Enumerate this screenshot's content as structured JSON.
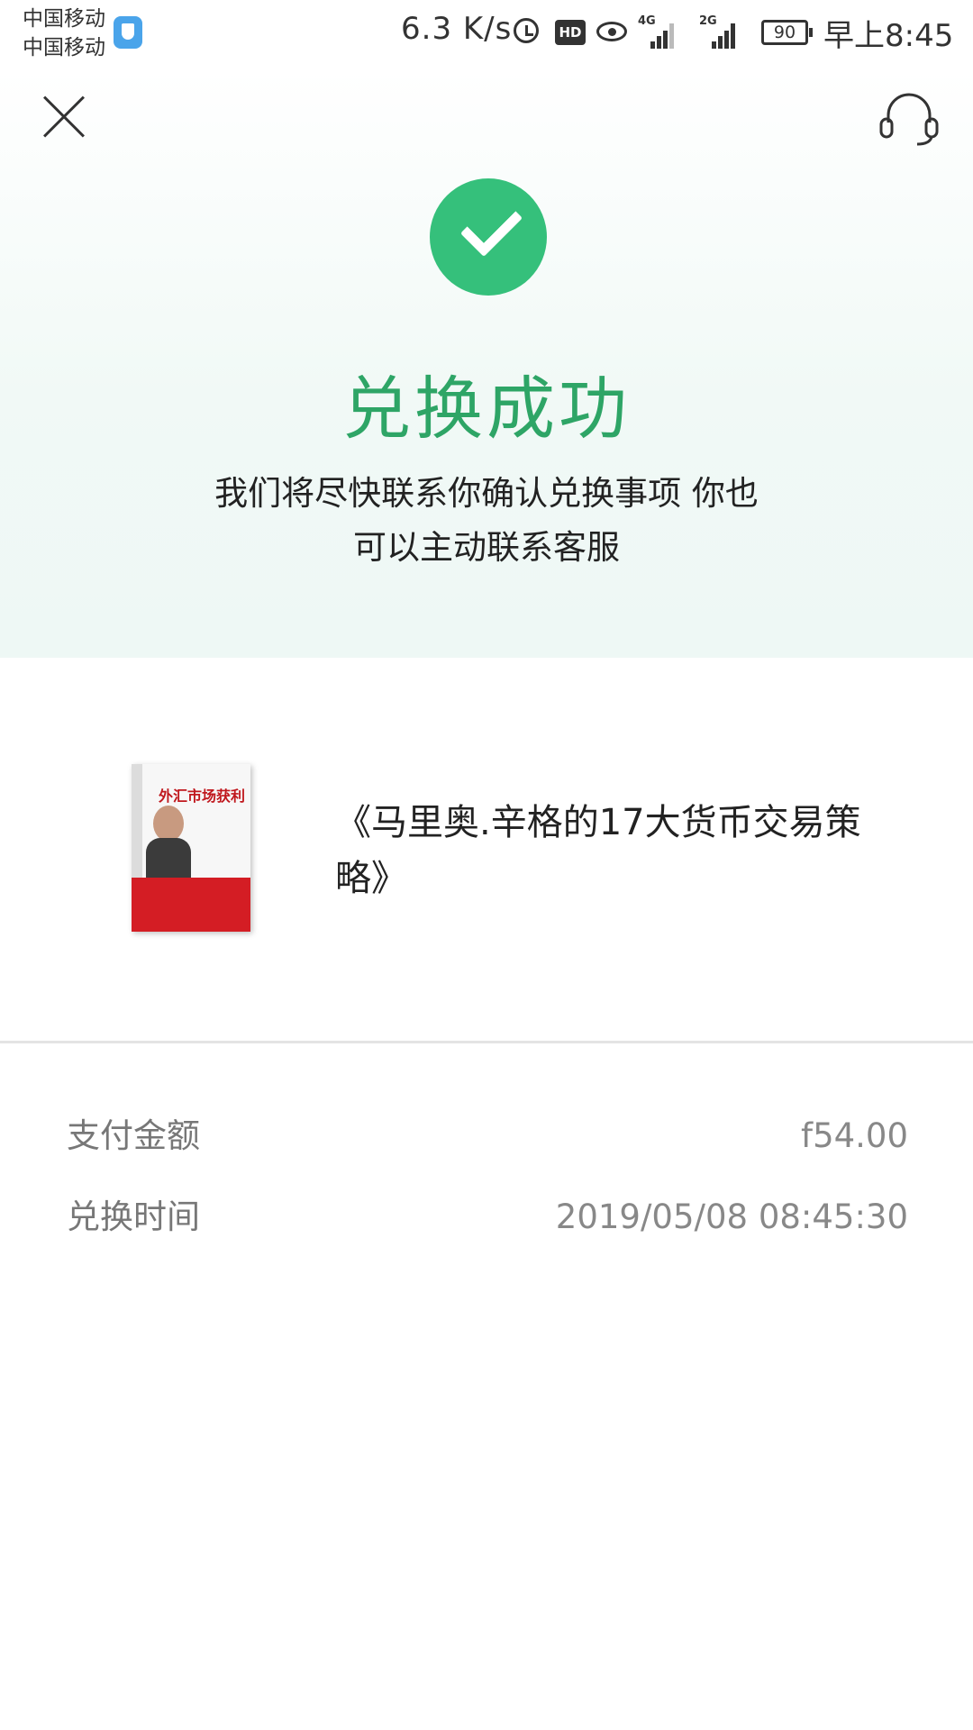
{
  "status_bar": {
    "carrier_1": "中国移动",
    "carrier_2": "中国移动",
    "net_speed": "6.3 K/s",
    "hd_badge": "HD",
    "signal_1_tag": "4G",
    "signal_2_tag": "2G",
    "battery": "90",
    "time": "早上8:45",
    "icons": [
      "shield-icon",
      "alarm-icon",
      "hd-icon",
      "eye-icon",
      "signal-4g-icon",
      "signal-2g-icon",
      "battery-icon"
    ]
  },
  "header": {
    "close_icon": "close-icon",
    "support_icon": "headset-icon"
  },
  "result": {
    "icon": "check-circle-icon",
    "title": "兑换成功",
    "description": "我们将尽快联系你确认兑换事项 你也可以主动联系客服",
    "accent_color": "#35c07b",
    "title_color": "#2ea566"
  },
  "product": {
    "name": "《马里奥.辛格的17大货币交易策略》",
    "cover_title": "外汇市场获利"
  },
  "details": {
    "amount_label": "支付金额",
    "amount_value": "f54.00",
    "time_label": "兑换时间",
    "time_value": "2019/05/08 08:45:30"
  }
}
